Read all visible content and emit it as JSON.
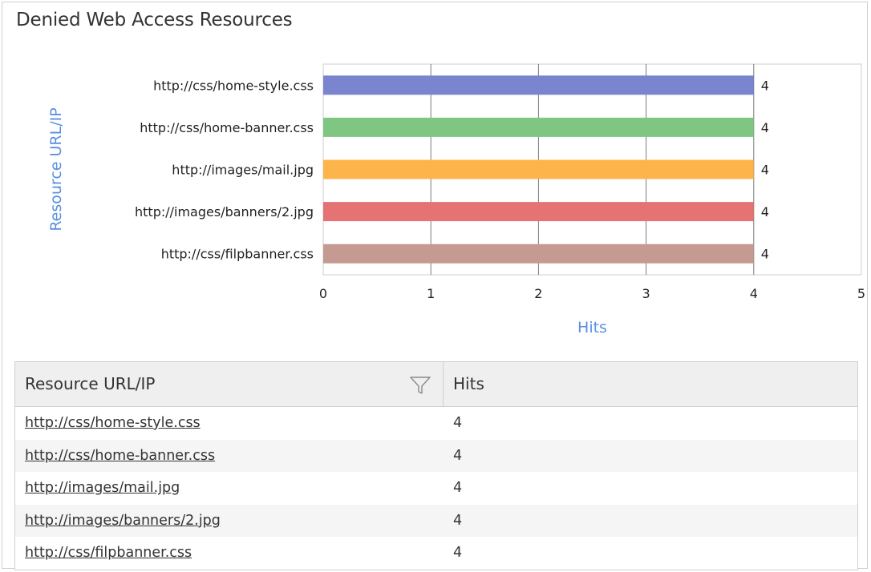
{
  "panel": {
    "title": "Denied Web Access Resources"
  },
  "chart_data": {
    "type": "bar",
    "orientation": "horizontal",
    "categories": [
      "http://css/home-style.css",
      "http://css/home-banner.css",
      "http://images/mail.jpg",
      "http://images/banners/2.jpg",
      "http://css/filpbanner.css"
    ],
    "values": [
      4,
      4,
      4,
      4,
      4
    ],
    "colors": [
      "#7b85cf",
      "#7ec682",
      "#fdb44b",
      "#e57373",
      "#c49a91"
    ],
    "xlabel": "Hits",
    "ylabel": "Resource URL/IP",
    "xlim": [
      0,
      5
    ],
    "xticks": [
      0,
      1,
      2,
      3,
      4,
      5
    ],
    "grid": true,
    "data_labels": true,
    "axis_title_color": "#5b8fe0"
  },
  "table": {
    "headers": {
      "resource": "Resource URL/IP",
      "hits": "Hits"
    },
    "rows": [
      {
        "resource": "http://css/home-style.css",
        "hits": "4"
      },
      {
        "resource": "http://css/home-banner.css",
        "hits": "4"
      },
      {
        "resource": "http://images/mail.jpg",
        "hits": "4"
      },
      {
        "resource": "http://images/banners/2.jpg",
        "hits": "4"
      },
      {
        "resource": "http://css/filpbanner.css",
        "hits": "4"
      }
    ]
  }
}
